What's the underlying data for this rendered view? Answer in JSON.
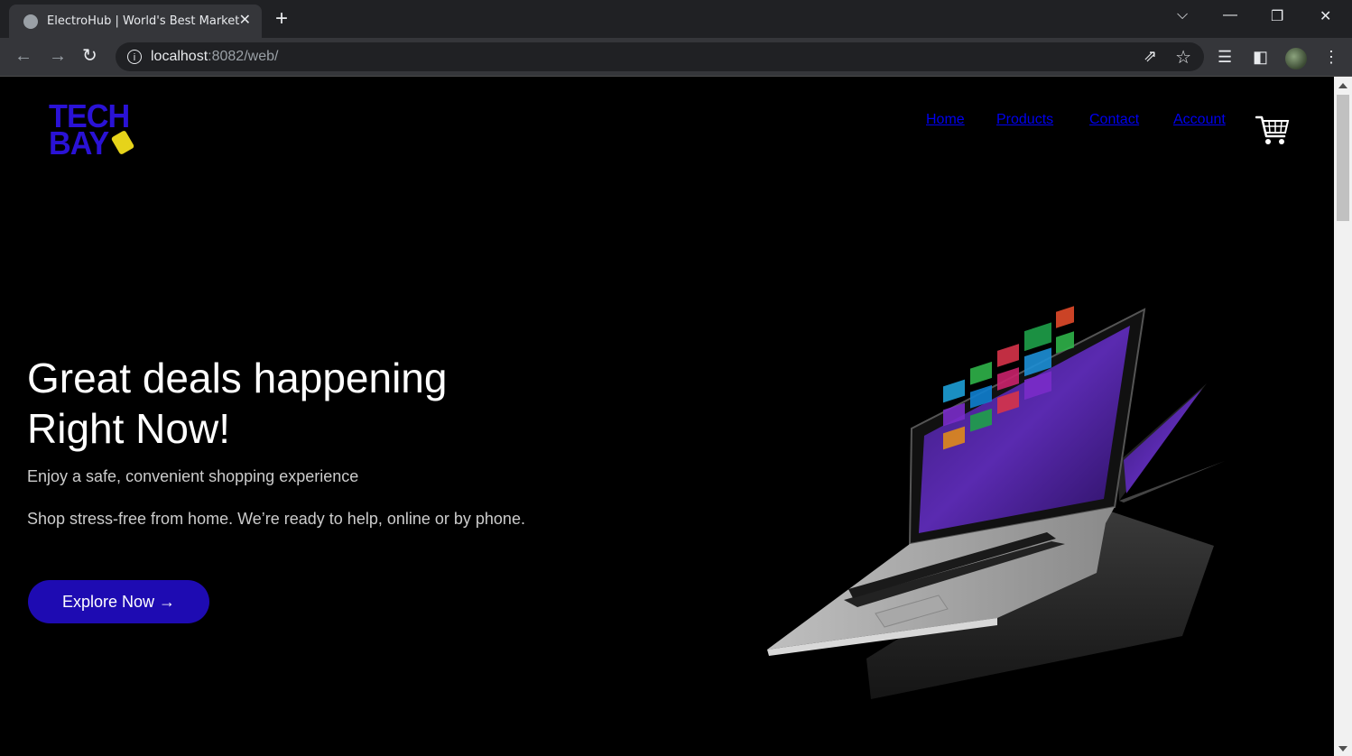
{
  "browser": {
    "tab_title": "ElectroHub | World's Best Market",
    "tab_close": "✕",
    "new_tab": "+",
    "url_host": "localhost",
    "url_path": ":8082/web/",
    "icons": [
      "back-icon",
      "forward-icon",
      "reload-icon",
      "info-icon",
      "share-icon",
      "bookmark-star-icon",
      "reading-list-icon",
      "side-panel-icon",
      "profile-avatar",
      "menu-icon"
    ]
  },
  "header": {
    "logo_line1": "TECH",
    "logo_line2": "BAY",
    "nav": {
      "home": "Home",
      "products": "Products",
      "contact": "Contact",
      "account": "Account"
    }
  },
  "hero": {
    "title_line1": "Great deals happening",
    "title_line2": "Right Now!",
    "subtitle": "Enjoy a safe, convenient shopping experience",
    "description": "Shop stress-free from home. We’re ready to help, online or by phone.",
    "cta_label": "Explore Now →"
  },
  "colors": {
    "brand": "#2a12d6",
    "cta": "#1e0bb2",
    "tag": "#e6d31a",
    "background": "#000000"
  }
}
